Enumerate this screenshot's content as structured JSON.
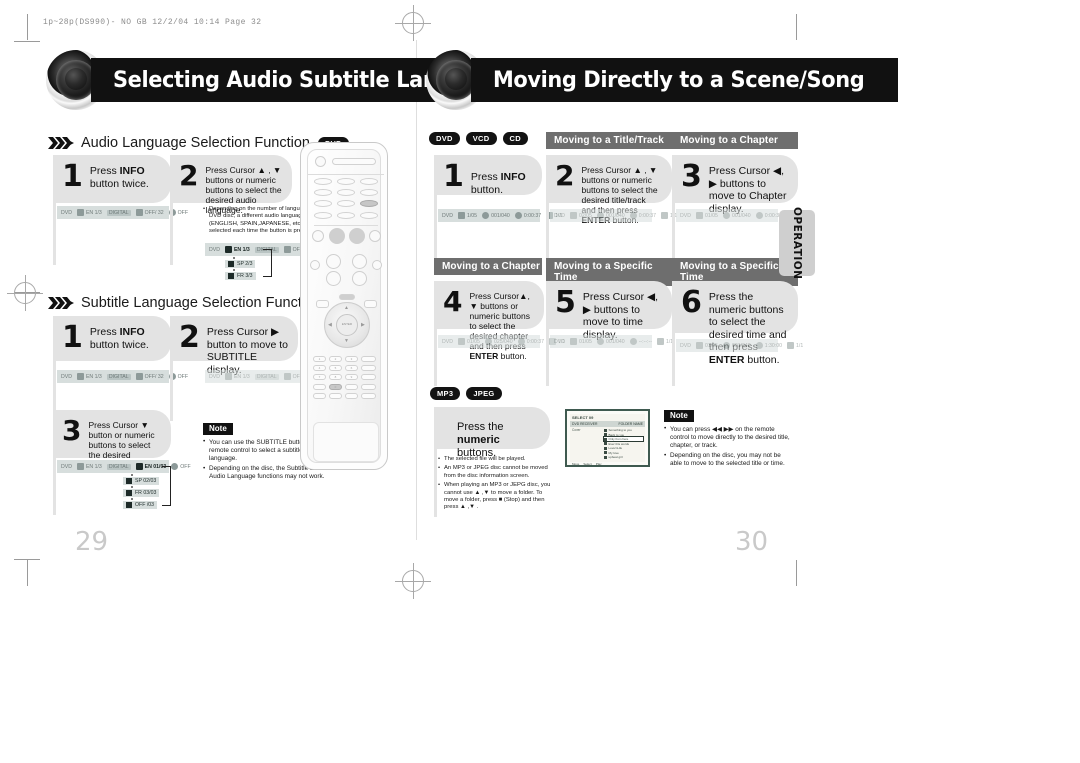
{
  "slug": "1p~28p(DS990)- NO GB  12/2/04 10:14  Page 32",
  "page_numbers": {
    "left": "29",
    "right": "30"
  },
  "side_tab": {
    "label": "OPERATION"
  },
  "left_page": {
    "title": "Selecting Audio Subtitle Language",
    "sections": [
      {
        "heading": "Audio Language Selection Function",
        "disc_badge": "DVD",
        "steps": [
          {
            "num": "1",
            "text_parts": [
              "Press ",
              "INFO",
              " button twice."
            ]
          },
          {
            "num": "2",
            "text_parts": [
              "Press Cursor ▲ , ▼ buttons or numeric buttons to select the desired audio language."
            ]
          }
        ],
        "bullets": [
          "Depending on the number of languages on a DVD disc, a different audio language (ENGLISH, SPAIN,JAPANESE, etc.) is selected each time the button is pressed."
        ],
        "osd_step1": [
          "DVD",
          "EN 1/3",
          "DIGITAL",
          "OFF/ 32",
          "OFF"
        ],
        "osd_step2": [
          "DVD",
          "EN 1/3",
          "DIGITAL",
          "OFF/ 32",
          "OFF"
        ],
        "osd_options": [
          "EN 1/3",
          "SP 2/3",
          "FR 3/3"
        ]
      },
      {
        "heading": "Subtitle Language Selection Function",
        "disc_badge": "DVD",
        "steps": [
          {
            "num": "1",
            "text_parts": [
              "Press ",
              "INFO",
              " button twice."
            ]
          },
          {
            "num": "2",
            "text_parts": [
              "Press Cursor ▶ button to move to SUBTITLE display."
            ]
          },
          {
            "num": "3",
            "text_parts": [
              "Press Cursor ▼ button or numeric buttons to select the desired subtitle."
            ]
          }
        ],
        "osd_step1": [
          "DVD",
          "EN 1/3",
          "DIGITAL",
          "OFF/ 32",
          "OFF"
        ],
        "osd_step2": [
          "DVD",
          "EN 1/3",
          "DIGITAL",
          "OFF/ 32",
          "OFF"
        ],
        "osd_step3": [
          "DVD",
          "EN 1/3",
          "DIGITAL",
          "EN 01/03",
          "OFF"
        ],
        "osd_options": [
          "EN 01/03",
          "SP 02/03",
          "FR 03/03",
          "OFF /03"
        ],
        "note": {
          "label": "Note",
          "items": [
            "You can use the SUBTITLE button on the remote control to select a subtitle language.",
            "Depending on the disc, the Subtitle and Audio Language functions may not work."
          ]
        }
      }
    ]
  },
  "right_page": {
    "title": "Moving Directly to a Scene/Song",
    "disc_badges": [
      "DVD",
      "VCD",
      "CD"
    ],
    "cards": [
      {
        "caption": "",
        "num": "1",
        "text_parts": [
          "Press ",
          "INFO",
          " button."
        ],
        "osd": [
          "DVD",
          "1/05",
          "001/040",
          "0:00:37",
          "1/1"
        ]
      },
      {
        "caption": "Moving to a Title/Track",
        "num": "2",
        "text_parts": [
          "Press Cursor ▲ , ▼ buttons or numeric buttons to select the desired title/track and then press ",
          "ENTER",
          " button."
        ],
        "osd": [
          "DVD",
          "02/05",
          "001/040",
          "0:00:37",
          "1/1"
        ]
      },
      {
        "caption": "Moving to a Chapter",
        "num": "3",
        "text_parts": [
          "Press Cursor ◀, ▶ buttons to move to Chapter display."
        ],
        "osd": [
          "DVD",
          "01/05",
          "001/040",
          "0:00:37",
          "1/1"
        ]
      },
      {
        "caption": "Moving to a Chapter",
        "num": "4",
        "text_parts": [
          "Press Cursor ▲, ▼ buttons or numeric buttons to select the desired chapter and then press ",
          "ENTER",
          " button."
        ],
        "osd": [
          "DVD",
          "01/05",
          "025/040",
          "0:00:37",
          "1/1"
        ]
      },
      {
        "caption": "Moving to a Specific Time",
        "num": "5",
        "text_parts": [
          "Press Cursor ◀, ▶ buttons to move to time display."
        ],
        "osd": [
          "DVD",
          "01/05",
          "001/040",
          "--:--:--",
          "1/1"
        ]
      },
      {
        "caption": "Moving to a Specific Time",
        "num": "6",
        "text_parts": [
          "Press the numeric buttons to select the desired time and then press ",
          "ENTER",
          " button."
        ],
        "osd": [
          "DVD",
          "01/05",
          "001/040",
          "1:30:00",
          "1/1"
        ]
      }
    ],
    "mp3_section": {
      "badges": [
        "MP3",
        "JPEG"
      ],
      "step_text_parts": [
        "Press the ",
        "numeric",
        " buttons."
      ],
      "bullets": [
        "The selected file will be played.",
        "An MP3 or JPEG disc cannot be moved from the disc information screen.",
        "When playing an MP3 or JEPG disc, you cannot use ▲ ,▼  to move a folder. To move a folder, press ■ (Stop) and then press ▲ ,▼ ."
      ],
      "tv_screen": {
        "title": "SELECT 09",
        "bar_left": "DVD RECEIVER",
        "bar_right": "FOLDER NAME",
        "left_label": "Cover",
        "items": [
          "Something to you",
          "Back to you",
          "Only from here",
          "Ever this words",
          "Love'nLife",
          "My love",
          "upbeat girl"
        ],
        "selected_index": 2,
        "footer": [
          "Move",
          "Select",
          "Play"
        ]
      }
    },
    "note": {
      "label": "Note",
      "items": [
        "You can press ◀◀ ▶▶ on the remote control to move directly to the desired title, chapter, or track.",
        "Depending on the disc, you may not be able to move to the selected title or time."
      ]
    }
  },
  "colors": {
    "step_bg": "#e3e3e3",
    "caption_bg": "#6e6e6e",
    "title_bg": "#111111",
    "osd_bg": "#d7dedd",
    "tab_bg": "#cfcfcf",
    "pagenum": "#c9c9c9"
  }
}
